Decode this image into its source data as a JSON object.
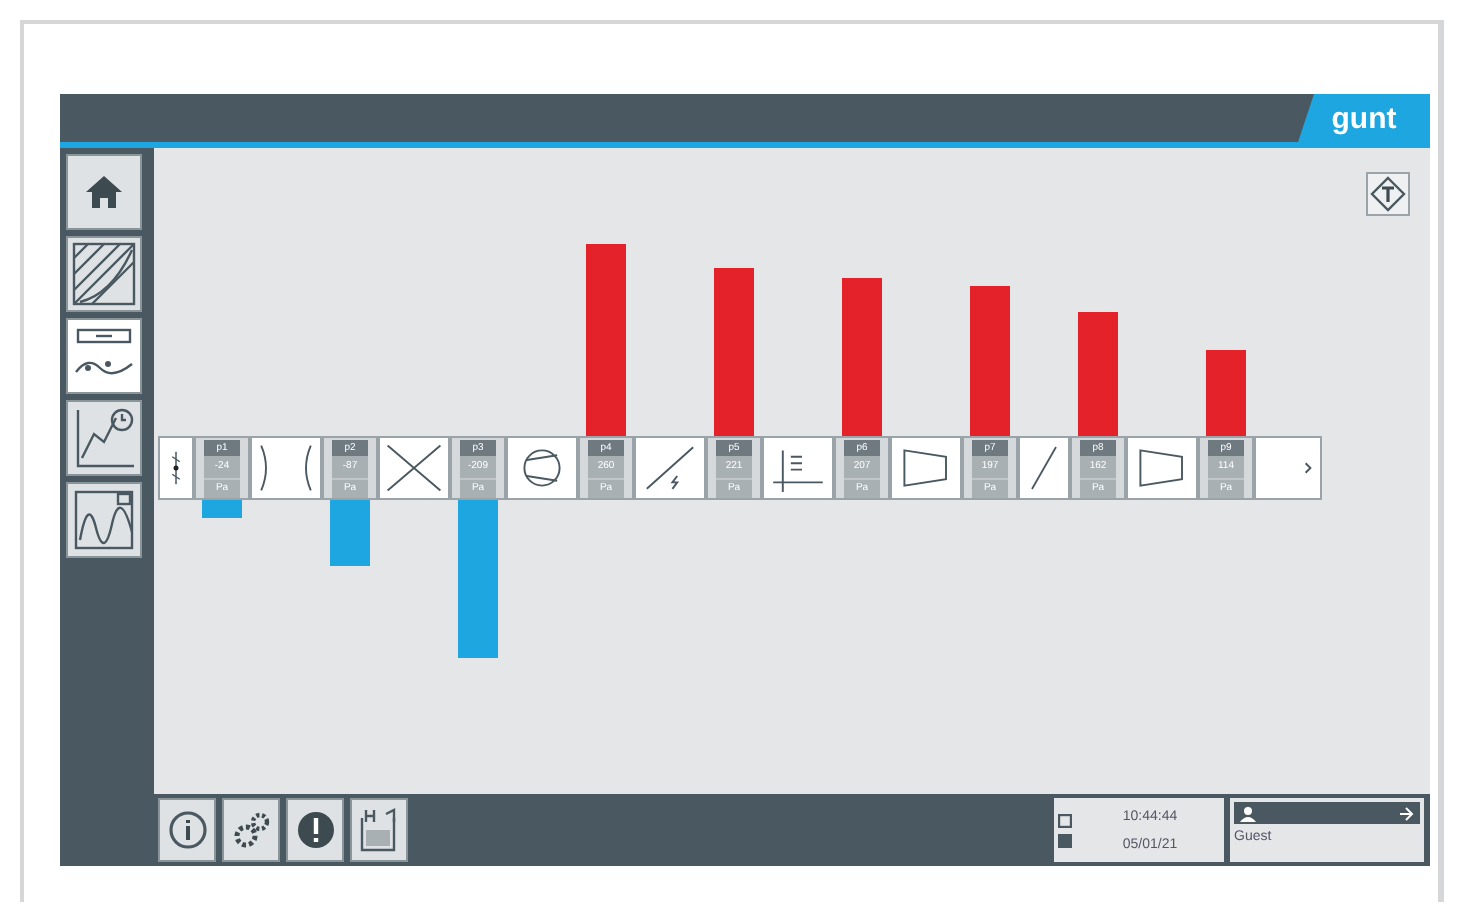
{
  "header": {
    "logo": "gunt"
  },
  "sidebar": {
    "items": [
      {
        "kind": "home",
        "selected": false
      },
      {
        "kind": "diagram",
        "selected": false
      },
      {
        "kind": "strip",
        "selected": true
      },
      {
        "kind": "timeplot",
        "selected": false
      },
      {
        "kind": "curve",
        "selected": false
      }
    ]
  },
  "strip": [
    {
      "kind": "valve"
    },
    {
      "kind": "suction",
      "label": "p1",
      "reading": "-24",
      "unit": "Pa"
    },
    {
      "kind": "nozzle"
    },
    {
      "kind": "suction",
      "label": "p2",
      "reading": "-87",
      "unit": "Pa"
    },
    {
      "kind": "filter"
    },
    {
      "kind": "suction",
      "label": "p3",
      "reading": "-209",
      "unit": "Pa"
    },
    {
      "kind": "fan"
    },
    {
      "kind": "pressure",
      "label": "p4",
      "reading": "260",
      "unit": "Pa"
    },
    {
      "kind": "heater"
    },
    {
      "kind": "pressure",
      "label": "p5",
      "reading": "221",
      "unit": "Pa"
    },
    {
      "kind": "straightener"
    },
    {
      "kind": "pressure",
      "label": "p6",
      "reading": "207",
      "unit": "Pa"
    },
    {
      "kind": "diffuser"
    },
    {
      "kind": "pressure",
      "label": "p7",
      "reading": "197",
      "unit": "Pa"
    },
    {
      "kind": "damper"
    },
    {
      "kind": "pressure",
      "label": "p8",
      "reading": "162",
      "unit": "Pa"
    },
    {
      "kind": "diffuser"
    },
    {
      "kind": "pressure",
      "label": "p9",
      "reading": "114",
      "unit": "Pa"
    },
    {
      "kind": "end"
    }
  ],
  "footer": {
    "tools": [
      {
        "kind": "info"
      },
      {
        "kind": "gears"
      },
      {
        "kind": "alert"
      },
      {
        "kind": "save"
      }
    ],
    "time": "10:44:44",
    "date": "05/01/21",
    "user": "Guest"
  }
}
